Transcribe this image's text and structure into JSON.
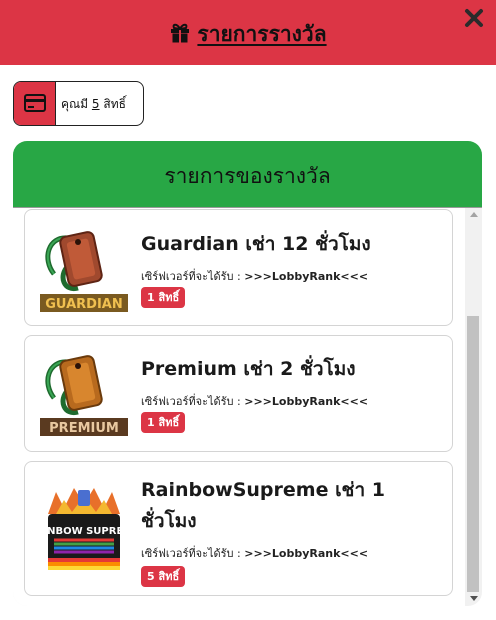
{
  "header": {
    "title": "รายการรางวัล",
    "gift_icon": "gift-icon",
    "close_icon": "close-icon",
    "bg_color": "#dc3545"
  },
  "credit": {
    "icon": "credit-card-icon",
    "prefix": "คุณมี",
    "amount": "5",
    "suffix": "สิทธิ์"
  },
  "rewards_panel": {
    "title": "รายการของรางวัล",
    "head_color": "#28a745",
    "items": [
      {
        "name": "Guardian เช่า 12 ชั่วโมง",
        "server_label": "เซิร์ฟเวอร์ที่จะได้รับ :",
        "server_value": ">>>LobbyRank<<<",
        "cost": "1 สิทธิ์",
        "image_label": "GUARDIAN"
      },
      {
        "name": "Premium เช่า 2 ชั่วโมง",
        "server_label": "เซิร์ฟเวอร์ที่จะได้รับ :",
        "server_value": ">>>LobbyRank<<<",
        "cost": "1 สิทธิ์",
        "image_label": "PREMIUM"
      },
      {
        "name": "RainbowSupreme เช่า 1 ชั่วโมง",
        "server_label": "เซิร์ฟเวอร์ที่จะได้รับ :",
        "server_value": ">>>LobbyRank<<<",
        "cost": "5 สิทธิ์",
        "image_label": "RAINBOW SUPREME"
      }
    ]
  },
  "scrollbar": {
    "up_icon": "scroll-up-arrow-icon",
    "down_icon": "scroll-down-arrow-icon"
  }
}
